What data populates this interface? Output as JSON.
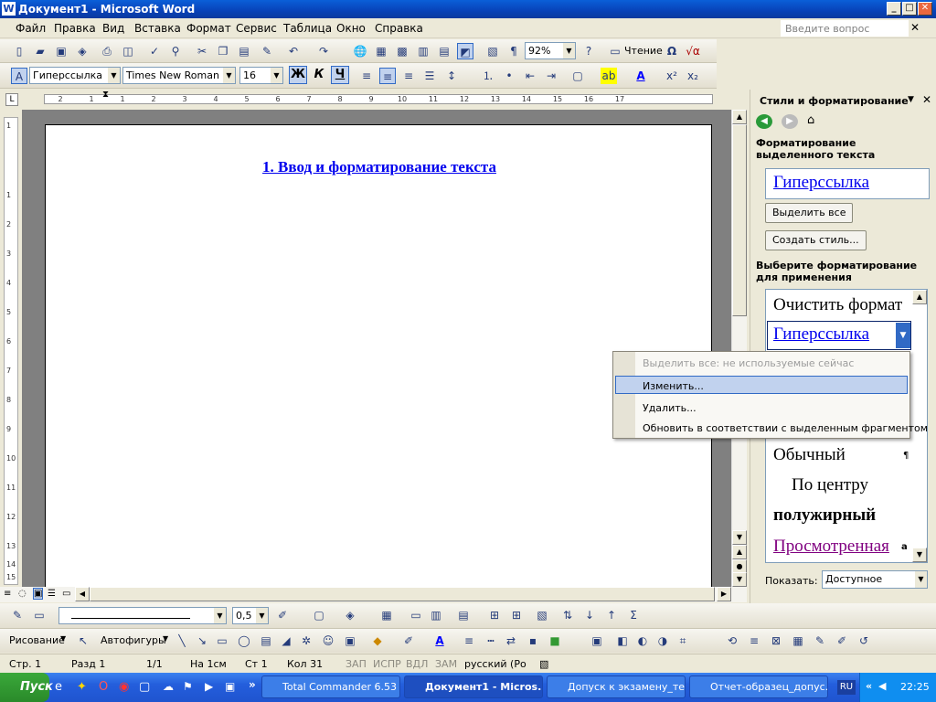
{
  "title": "Документ1 - Microsoft Word",
  "app_icon": "W",
  "menu": [
    "Файл",
    "Правка",
    "Вид",
    "Вставка",
    "Формат",
    "Сервис",
    "Таблица",
    "Окно",
    "Справка"
  ],
  "help_placeholder": "Введите вопрос",
  "toolbar1": {
    "zoom": "92%",
    "reading": "Чтение"
  },
  "toolbar2": {
    "style": "Гиперссылка",
    "font": "Times New Roman",
    "size": "16",
    "bold": "Ж",
    "italic": "К",
    "underline": "Ч"
  },
  "ruler_marks": [
    "2",
    "1",
    "1",
    "2",
    "3",
    "4",
    "5",
    "6",
    "7",
    "8",
    "9",
    "10",
    "11",
    "12",
    "13",
    "14",
    "15",
    "16",
    "17"
  ],
  "vruler_marks": [
    "1",
    "1",
    "2",
    "3",
    "4",
    "5",
    "6",
    "7",
    "8",
    "9",
    "10",
    "11",
    "12",
    "13",
    "14",
    "15"
  ],
  "document": {
    "heading": "1. Ввод и форматирование текста"
  },
  "pane": {
    "title": "Стили и форматирование",
    "selected_section": "Форматирование выделенного текста",
    "selected_style": "Гиперссылка",
    "select_all": "Выделить все",
    "create_style": "Создать стиль...",
    "apply_section": "Выберите форматирование для применения",
    "styles": [
      "Очистить формат",
      "Гиперссылка",
      "Обычный",
      "По центру",
      "полужирный",
      "Просмотренная"
    ],
    "show_label": "Показать:",
    "show_value": "Доступное"
  },
  "context_menu": [
    "Выделить все: не используемые сейчас",
    "Изменить...",
    "Удалить...",
    "Обновить в соответствии с выделенным фрагментом"
  ],
  "draw_toolbar": {
    "line_width": "0,5",
    "drawing": "Рисование",
    "autoshapes": "Автофигуры"
  },
  "status": {
    "page": "Стр. 1",
    "section": "Разд 1",
    "pages": "1/1",
    "at": "На 1см",
    "line": "Ст 1",
    "col": "Кол 31",
    "rec": "ЗАП",
    "trk": "ИСПР",
    "ext": "ВДЛ",
    "ovr": "ЗАМ",
    "lang": "русский (Ро"
  },
  "taskbar": {
    "start": "Пуск",
    "tasks": [
      "Total Commander 6.53 ...",
      "Документ1 - Micros...",
      "Допуск к экзамену_те...",
      "Отчет-образец_допус..."
    ],
    "lang": "RU",
    "time": "22:25"
  },
  "colors": {
    "link": "#0000ee",
    "visited": "#800080",
    "titlebar": "#0842b8"
  }
}
